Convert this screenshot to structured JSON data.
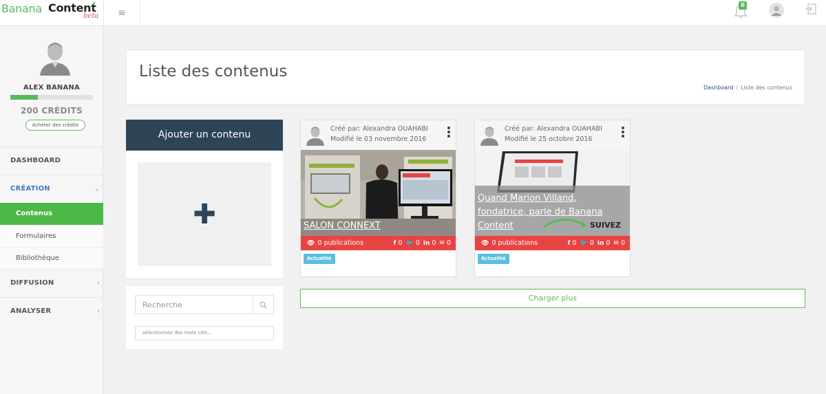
{
  "app": {
    "logo_part1": "Banana",
    "logo_part2": "Content",
    "logo_badge": "beta",
    "notification_count": "0"
  },
  "sidebar": {
    "username": "ALEX BANANA",
    "credits": "200 CRÉDITS",
    "credits_progress": 0.33,
    "buy_label": "Acheter des crédits",
    "nav": {
      "dashboard": "DASHBOARD",
      "creation": "CRÉATION",
      "contenus": "Contenus",
      "formulaires": "Formulaires",
      "bibliotheque": "Bibliothèque",
      "diffusion": "DIFFUSION",
      "analyser": "ANALYSER"
    }
  },
  "header": {
    "title": "Liste des contenus",
    "breadcrumb_home": "Dashboard",
    "breadcrumb_sep": "/",
    "breadcrumb_current": "Liste des contenus"
  },
  "add_panel": {
    "label": "Ajouter un contenu"
  },
  "search": {
    "placeholder": "Recherche",
    "tags_placeholder": "sélectionnez des mots clés..."
  },
  "cards": [
    {
      "author": "Créé par: Alexandra OUAHABI",
      "modified": "Modifié le 03 novembre 2016",
      "title": "SALON CONNEXT",
      "publications": "0 publications",
      "facebook": "0",
      "twitter": "0",
      "linkedin": "0",
      "email": "0",
      "tag": "Actualité"
    },
    {
      "author": "Créé par: Alexandra OUAHABI",
      "modified": "Modifié le 25 octobre 2016",
      "title": "Quand Marion Villand, fondatrice, parle de Banana Content",
      "image_text": "SUIVEZ",
      "publications": "0 publications",
      "facebook": "0",
      "twitter": "0",
      "linkedin": "0",
      "email": "0",
      "tag": "Actualité"
    }
  ],
  "load_more": "Charger plus",
  "colors": {
    "brand_green": "#5cb85c",
    "navy": "#2e4457",
    "stats_red": "#e84343",
    "tag_blue": "#5bc0de"
  }
}
